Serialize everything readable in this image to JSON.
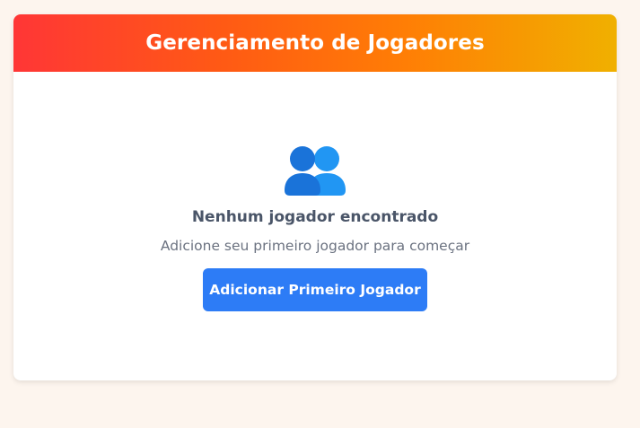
{
  "header": {
    "title": "Gerenciamento de Jogadores"
  },
  "empty_state": {
    "icon": "users-icon",
    "title": "Nenhum jogador encontrado",
    "subtitle": "Adicione seu primeiro jogador para começar",
    "button_label": "Adicionar Primeiro Jogador"
  },
  "colors": {
    "page_background": "#fdf5ee",
    "header_gradient": [
      "#ff3636",
      "#ff5a14",
      "#ff7e05",
      "#f0b000"
    ],
    "button": "#2d7cf6",
    "icon_primary": "#1a73d9",
    "icon_secondary": "#2196f3"
  }
}
